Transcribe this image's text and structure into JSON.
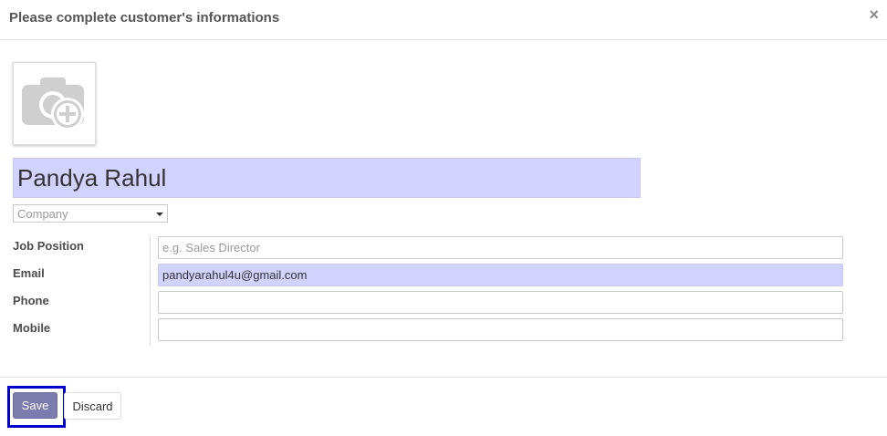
{
  "dialog": {
    "title": "Please complete customer's informations",
    "close_glyph": "×"
  },
  "avatar": {
    "icon": "camera-plus-icon"
  },
  "form": {
    "name_value": "Pandya Rahul",
    "company": {
      "placeholder": "Company"
    },
    "fields": {
      "job_position": {
        "label": "Job Position",
        "value": "",
        "placeholder": "e.g. Sales Director"
      },
      "email": {
        "label": "Email",
        "value": "pandyarahul4u@gmail.com",
        "placeholder": ""
      },
      "phone": {
        "label": "Phone",
        "value": "",
        "placeholder": ""
      },
      "mobile": {
        "label": "Mobile",
        "value": "",
        "placeholder": ""
      }
    }
  },
  "footer": {
    "save_label": "Save",
    "discard_label": "Discard"
  },
  "colors": {
    "primary": "#7c7bad",
    "focus_highlight": "#0000cc",
    "required_field_bg": "#d2d2ff"
  }
}
